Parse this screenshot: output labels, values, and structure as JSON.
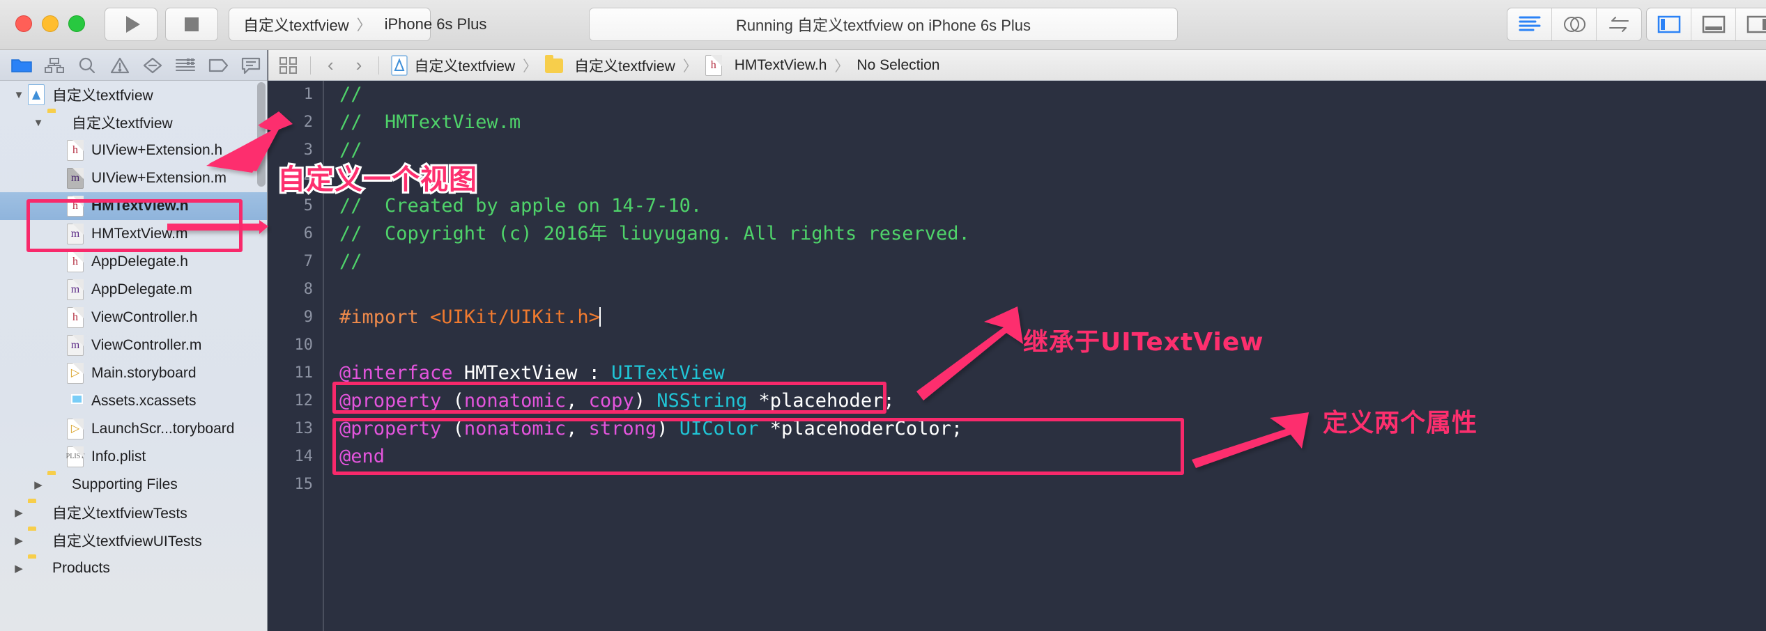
{
  "window": {
    "traffic_lights": [
      "close",
      "minimize",
      "maximize"
    ],
    "run_label": "Run",
    "stop_label": "Stop",
    "scheme_project": "自定义textfview",
    "scheme_destination": "iPhone 6s Plus",
    "status_text": "Running 自定义textfview on iPhone 6s Plus",
    "editor_modes": [
      "standard-editor",
      "assistant-editor",
      "version-editor"
    ],
    "view_toggles": [
      "navigator-toggle",
      "debug-area-toggle",
      "utilities-toggle"
    ]
  },
  "navigator_toolbar": {
    "icons": [
      {
        "name": "project-navigator-icon",
        "selected": true
      },
      {
        "name": "symbol-navigator-icon",
        "selected": false
      },
      {
        "name": "find-navigator-icon",
        "selected": false
      },
      {
        "name": "issue-navigator-icon",
        "selected": false
      },
      {
        "name": "test-navigator-icon",
        "selected": false
      },
      {
        "name": "debug-navigator-icon",
        "selected": false
      },
      {
        "name": "breakpoint-navigator-icon",
        "selected": false
      },
      {
        "name": "report-navigator-icon",
        "selected": false
      }
    ]
  },
  "jump_bar": {
    "related_items_label": "Related Items",
    "back_label": "‹",
    "forward_label": "›",
    "crumbs": [
      {
        "icon": "project-icon",
        "label": "自定义textfview"
      },
      {
        "icon": "folder-icon",
        "label": "自定义textfview"
      },
      {
        "icon": "header-file-icon",
        "label": "HMTextView.h"
      },
      {
        "icon": "none",
        "label": "No Selection"
      }
    ],
    "separator": "〉"
  },
  "navigator": {
    "rows": [
      {
        "indent": 0,
        "twisty": "▼",
        "icon": "project",
        "label": "自定义textfview",
        "selected": false
      },
      {
        "indent": 1,
        "twisty": "▼",
        "icon": "folder",
        "label": "自定义textfview",
        "selected": false
      },
      {
        "indent": 2,
        "twisty": "",
        "icon": "h",
        "label": "UIView+Extension.h",
        "selected": false
      },
      {
        "indent": 2,
        "twisty": "",
        "icon": "mgray",
        "label": "UIView+Extension.m",
        "selected": false
      },
      {
        "indent": 2,
        "twisty": "",
        "icon": "h",
        "label": "HMTextView.h",
        "selected": true
      },
      {
        "indent": 2,
        "twisty": "",
        "icon": "m",
        "label": "HMTextView.m",
        "selected": false
      },
      {
        "indent": 2,
        "twisty": "",
        "icon": "h",
        "label": "AppDelegate.h",
        "selected": false
      },
      {
        "indent": 2,
        "twisty": "",
        "icon": "m",
        "label": "AppDelegate.m",
        "selected": false
      },
      {
        "indent": 2,
        "twisty": "",
        "icon": "h",
        "label": "ViewController.h",
        "selected": false
      },
      {
        "indent": 2,
        "twisty": "",
        "icon": "m",
        "label": "ViewController.m",
        "selected": false
      },
      {
        "indent": 2,
        "twisty": "",
        "icon": "storyboard",
        "label": "Main.storyboard",
        "selected": false
      },
      {
        "indent": 2,
        "twisty": "",
        "icon": "xcassets",
        "label": "Assets.xcassets",
        "selected": false
      },
      {
        "indent": 2,
        "twisty": "",
        "icon": "storyboard",
        "label": "LaunchScr...toryboard",
        "selected": false
      },
      {
        "indent": 2,
        "twisty": "",
        "icon": "plist",
        "label": "Info.plist",
        "selected": false
      },
      {
        "indent": 1,
        "twisty": "▶",
        "icon": "folder",
        "label": "Supporting Files",
        "selected": false
      },
      {
        "indent": 0,
        "twisty": "▶",
        "icon": "folder",
        "label": "自定义textfviewTests",
        "selected": false
      },
      {
        "indent": 0,
        "twisty": "▶",
        "icon": "folder",
        "label": "自定义textfviewUITests",
        "selected": false
      },
      {
        "indent": 0,
        "twisty": "▶",
        "icon": "folder",
        "label": "Products",
        "selected": false
      }
    ]
  },
  "editor": {
    "line_numbers": [
      "1",
      "2",
      "3",
      "4",
      "5",
      "6",
      "7",
      "8",
      "9",
      "10",
      "11",
      "12",
      "13",
      "14",
      "15"
    ],
    "lines": [
      {
        "n": 1,
        "tokens": [
          {
            "t": "//",
            "c": "c-com"
          }
        ]
      },
      {
        "n": 2,
        "tokens": [
          {
            "t": "//  HMTextView.m",
            "c": "c-com"
          }
        ]
      },
      {
        "n": 3,
        "tokens": [
          {
            "t": "//",
            "c": "c-com"
          }
        ]
      },
      {
        "n": 4,
        "tokens": [
          {
            "t": "//",
            "c": "c-com"
          }
        ]
      },
      {
        "n": 5,
        "tokens": [
          {
            "t": "//  Created by apple on 14-7-10.",
            "c": "c-com"
          }
        ]
      },
      {
        "n": 6,
        "tokens": [
          {
            "t": "//  Copyright (c) 2016年 liuyugang. All rights reserved.",
            "c": "c-com"
          }
        ]
      },
      {
        "n": 7,
        "tokens": [
          {
            "t": "//",
            "c": "c-com"
          }
        ]
      },
      {
        "n": 8,
        "tokens": []
      },
      {
        "n": 9,
        "tokens": [
          {
            "t": "#import ",
            "c": "c-pre"
          },
          {
            "t": "<UIKit/UIKit.h>",
            "c": "c-str"
          },
          {
            "t": "",
            "c": "caret"
          }
        ]
      },
      {
        "n": 10,
        "tokens": []
      },
      {
        "n": 11,
        "tokens": [
          {
            "t": "@interface ",
            "c": "c-kw"
          },
          {
            "t": "HMTextView ",
            "c": "c-wh"
          },
          {
            "t": ": ",
            "c": "c-wh"
          },
          {
            "t": "UITextView",
            "c": "c-type"
          }
        ]
      },
      {
        "n": 12,
        "tokens": [
          {
            "t": "@property ",
            "c": "c-kw"
          },
          {
            "t": "(",
            "c": "c-wh"
          },
          {
            "t": "nonatomic",
            "c": "c-kw"
          },
          {
            "t": ", ",
            "c": "c-wh"
          },
          {
            "t": "copy",
            "c": "c-kw"
          },
          {
            "t": ") ",
            "c": "c-wh"
          },
          {
            "t": "NSString ",
            "c": "c-type"
          },
          {
            "t": "*placehoder;",
            "c": "c-wh"
          }
        ]
      },
      {
        "n": 13,
        "tokens": [
          {
            "t": "@property ",
            "c": "c-kw"
          },
          {
            "t": "(",
            "c": "c-wh"
          },
          {
            "t": "nonatomic",
            "c": "c-kw"
          },
          {
            "t": ", ",
            "c": "c-wh"
          },
          {
            "t": "strong",
            "c": "c-kw"
          },
          {
            "t": ") ",
            "c": "c-wh"
          },
          {
            "t": "UIColor ",
            "c": "c-type"
          },
          {
            "t": "*placehoderColor;",
            "c": "c-wh"
          }
        ]
      },
      {
        "n": 14,
        "tokens": [
          {
            "t": "@end",
            "c": "c-kw"
          }
        ]
      },
      {
        "n": 15,
        "tokens": []
      }
    ]
  },
  "annotations": {
    "accent_color": "#fd2f6e",
    "labels": [
      {
        "id": "ann-define-view",
        "text": "自定义一个视图"
      },
      {
        "id": "ann-inherit",
        "text": "继承于UITextView"
      },
      {
        "id": "ann-two-props",
        "text": "定义两个属性"
      }
    ],
    "highlight_boxes": [
      {
        "id": "ann-box-files",
        "target": "HMTextView.h / HMTextView.m in navigator"
      },
      {
        "id": "ann-box-interface",
        "target": "@interface line"
      },
      {
        "id": "ann-box-properties",
        "target": "@property lines"
      }
    ]
  }
}
